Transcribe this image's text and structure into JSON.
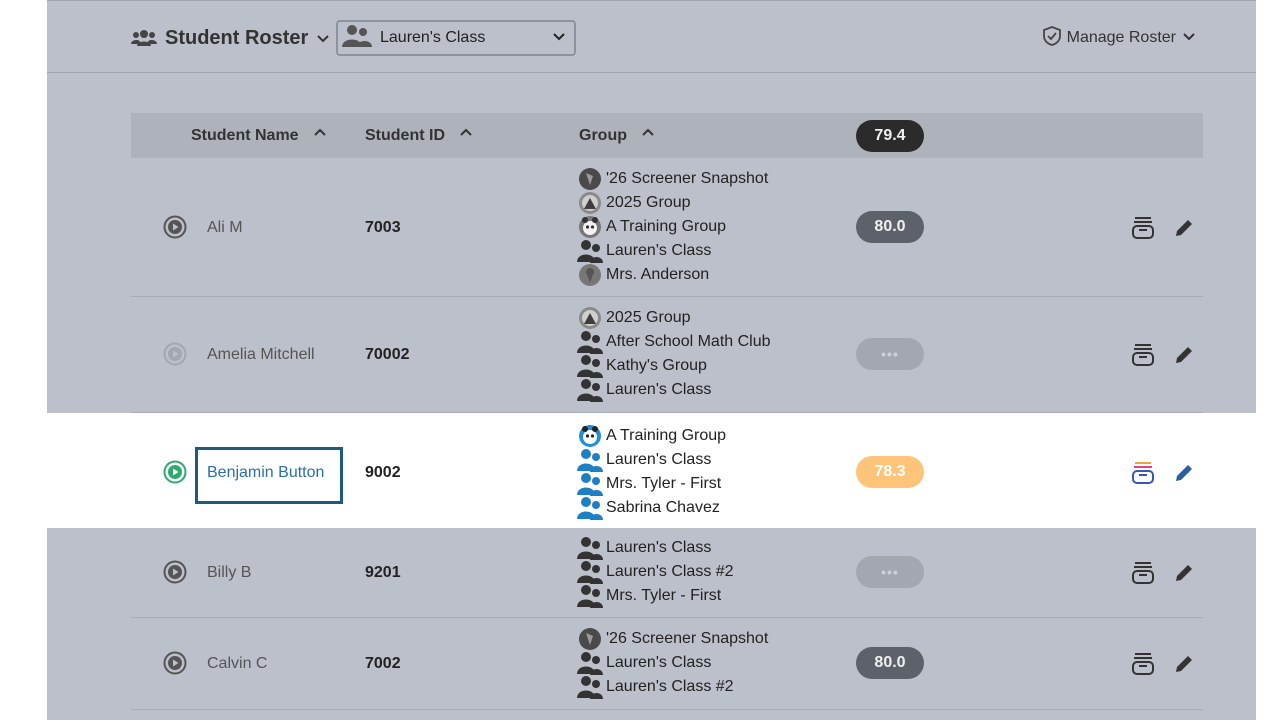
{
  "header": {
    "title": "Student Roster",
    "class_select_value": "Lauren's Class",
    "manage_label": "Manage Roster"
  },
  "table": {
    "columns": {
      "name": "Student Name",
      "id": "Student ID",
      "group": "Group",
      "average": "79.4"
    },
    "rows": [
      {
        "name": "Ali M",
        "id": "7003",
        "score": "80.0",
        "groups": [
          "'26 Screener Snapshot",
          "2025 Group",
          "A Training Group",
          "Lauren's Class",
          "Mrs. Anderson"
        ]
      },
      {
        "name": "Amelia Mitchell",
        "id": "70002",
        "score": "•••",
        "groups": [
          "2025 Group",
          "After School Math Club",
          "Kathy's Group",
          "Lauren's Class"
        ]
      },
      {
        "name": "Benjamin Button",
        "id": "9002",
        "score": "78.3",
        "groups": [
          "A Training Group",
          "Lauren's Class",
          "Mrs. Tyler - First",
          "Sabrina Chavez"
        ]
      },
      {
        "name": "Billy B",
        "id": "9201",
        "score": "•••",
        "groups": [
          "Lauren's Class",
          "Lauren's Class #2",
          "Mrs. Tyler - First"
        ]
      },
      {
        "name": "Calvin C",
        "id": "7002",
        "score": "80.0",
        "groups": [
          "'26 Screener Snapshot",
          "Lauren's Class",
          "Lauren's Class #2"
        ]
      }
    ]
  },
  "colors": {
    "app_bg": "#bcc0ca",
    "header_row_bg": "#aeb2bb",
    "highlight_bg": "#ffffff",
    "link_blue": "#2a6fa8",
    "focus_border": "#1d5a7c",
    "score_dark": "#5d6169",
    "score_orange": "#fdc47a",
    "play_green": "#2eaa6e"
  }
}
